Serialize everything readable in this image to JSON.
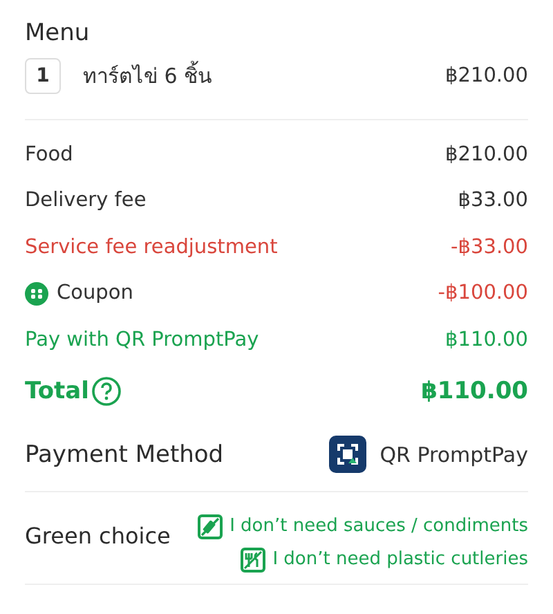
{
  "menu": {
    "title": "Menu",
    "items": [
      {
        "quantity": "1",
        "name": "ทาร์ตไข่ 6 ชิ้น",
        "price": "฿210.00"
      }
    ]
  },
  "summary": [
    {
      "kind": "plain",
      "label": "Food",
      "amount": "฿210.00"
    },
    {
      "kind": "plain",
      "label": "Delivery fee",
      "amount": "฿33.00"
    },
    {
      "kind": "adjustment",
      "label": "Service fee readjustment",
      "amount": "-฿33.00"
    },
    {
      "kind": "coupon",
      "label": "Coupon",
      "amount": "-฿100.00"
    },
    {
      "kind": "payment",
      "label": "Pay with QR PromptPay",
      "amount": "฿110.00"
    }
  ],
  "total": {
    "label": "Total",
    "amount": "฿110.00"
  },
  "payment_method": {
    "label": "Payment Method",
    "value": "QR PromptPay"
  },
  "green_choice": {
    "label": "Green choice",
    "options": [
      {
        "kind": "sauce",
        "text": "I don’t need sauces / condiments"
      },
      {
        "kind": "cutlery",
        "text": "I don’t need plastic cutleries"
      }
    ]
  }
}
